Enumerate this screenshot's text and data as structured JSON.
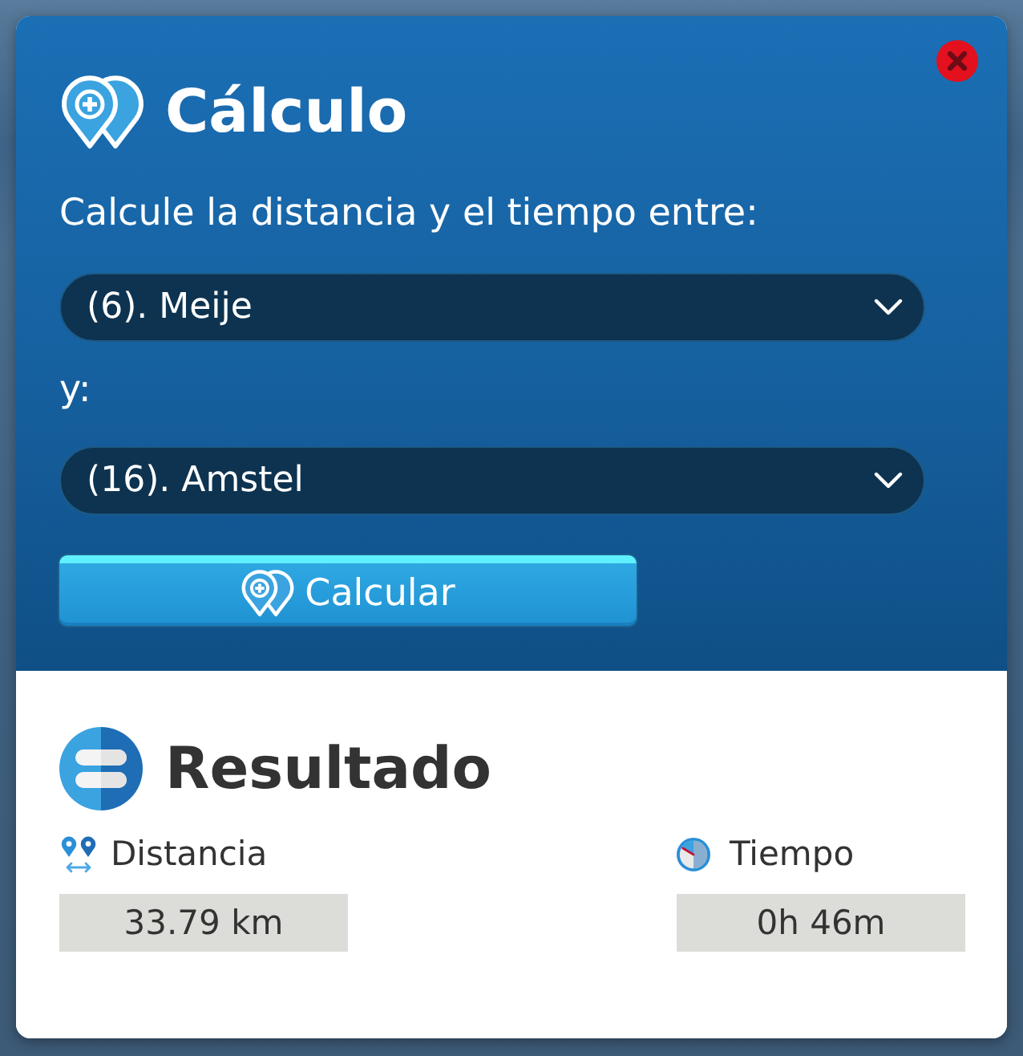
{
  "dialog": {
    "title": "Cálculo",
    "prompt": "Calcule la distancia y el tiempo entre:",
    "origin": {
      "value": "(6). Meije"
    },
    "connector": "y:",
    "destination": {
      "value": "(16). Amstel"
    },
    "calculate_button": "Calcular"
  },
  "result": {
    "title": "Resultado",
    "metrics": [
      {
        "kind": "distance",
        "label": "Distancia",
        "value": "33.79 km"
      },
      {
        "kind": "time",
        "label": "Tiempo",
        "value": "0h 46m"
      }
    ]
  }
}
